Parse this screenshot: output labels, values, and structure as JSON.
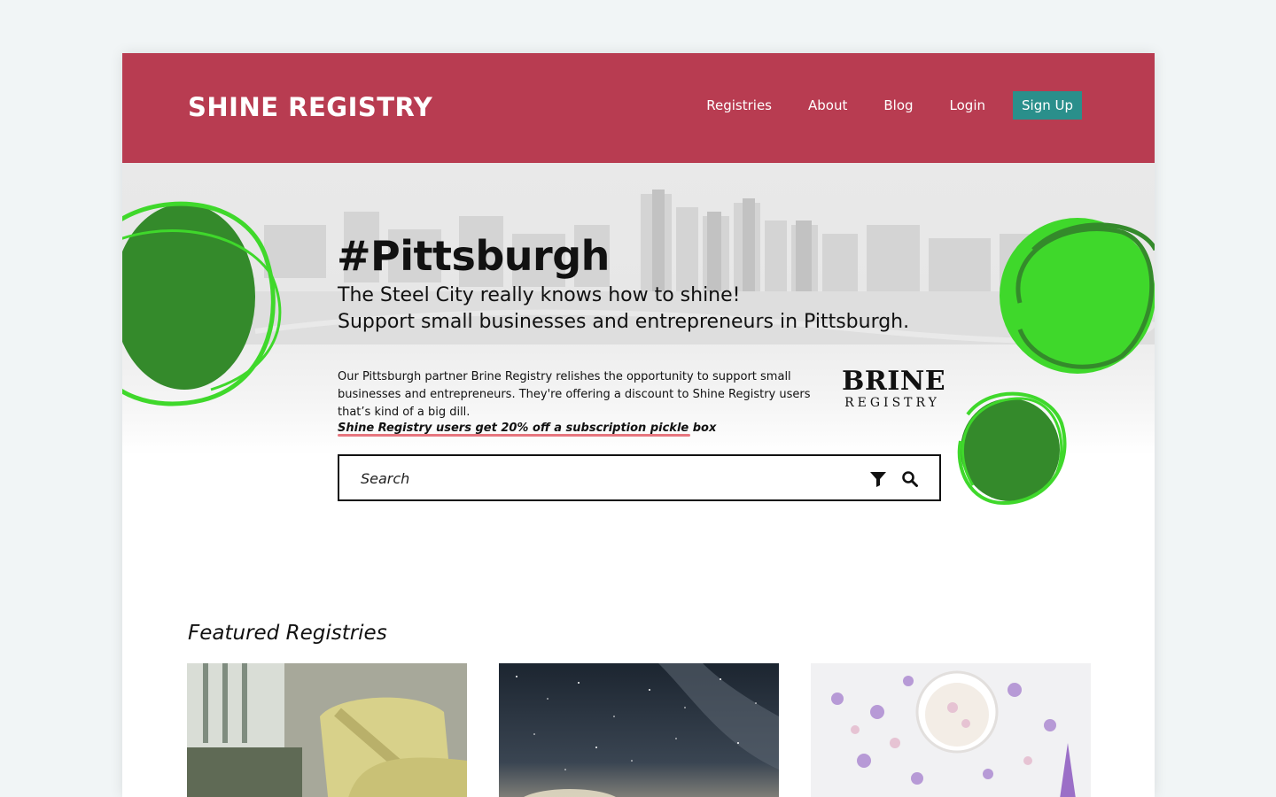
{
  "colors": {
    "header_bg": "#b83c51",
    "signup_bg": "#2a8f8b",
    "blob_dark": "#348a2b",
    "blob_bright": "#3fd82b",
    "promo_underline": "#e7767f"
  },
  "header": {
    "brand": "SHINE REGISTRY",
    "nav": [
      "Registries",
      "About",
      "Blog",
      "Login"
    ],
    "signup_label": "Sign Up"
  },
  "hero": {
    "title": "#Pittsburgh",
    "subtitle_line1": "The Steel City really knows how to shine!",
    "subtitle_line2": "Support small businesses and entrepreneurs in Pittsburgh.",
    "partner_text": "Our Pittsburgh partner Brine Registry relishes the opportunity to support small businesses and entrepreneurs. They're offering a discount to Shine Registry users that’s kind of a big dill.",
    "promo": "Shine Registry users get 20% off a subscription pickle box",
    "partner_logo": {
      "word": "BRINE",
      "sub": "REGISTRY"
    }
  },
  "search": {
    "placeholder": "Search",
    "icons": [
      "filter-icon",
      "search-icon"
    ]
  },
  "featured": {
    "title": "Featured Registries",
    "cards": [
      {
        "image": "yellow-armchair-photo"
      },
      {
        "image": "starry-night-sky-photo"
      },
      {
        "image": "flower-petals-bowl-photo"
      }
    ]
  }
}
